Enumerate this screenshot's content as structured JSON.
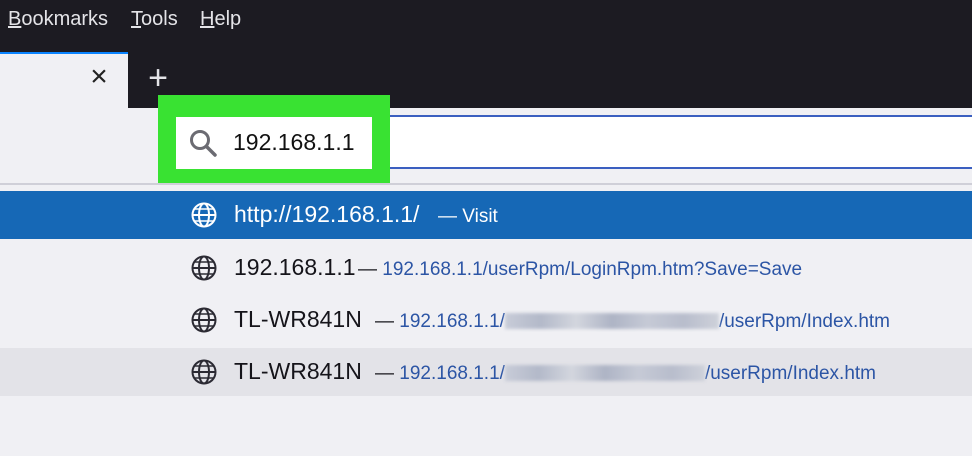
{
  "menu": {
    "bookmarks": {
      "underlined": "B",
      "rest": "ookmarks"
    },
    "tools": {
      "underlined": "T",
      "rest": "ools"
    },
    "help": {
      "underlined": "H",
      "rest": "elp"
    }
  },
  "tab": {
    "close_glyph": "×",
    "new_tab_glyph": "+"
  },
  "urlbar": {
    "value": "192.168.1.1"
  },
  "suggestions": [
    {
      "title": "http://192.168.1.1/",
      "separator": "—",
      "action": "Visit",
      "url": ""
    },
    {
      "title": "192.168.1.1",
      "separator": "—",
      "url": "192.168.1.1/userRpm/LoginRpm.htm?Save=Save"
    },
    {
      "title": "TL-WR841N",
      "separator": "—",
      "url_prefix": "192.168.1.1/",
      "url_suffix": "/userRpm/Index.htm"
    },
    {
      "title": "TL-WR841N",
      "separator": "—",
      "url_prefix": "192.168.1.1/",
      "url_suffix": "/userRpm/Index.htm"
    }
  ],
  "icons": {
    "search": "search-icon",
    "globe": "globe-icon",
    "close": "close-icon",
    "plus": "plus-icon"
  },
  "colors": {
    "highlight": "#39e232",
    "selected_row": "#1668b6",
    "link": "#2c55a5",
    "menubar_bg": "#1c1b22"
  }
}
